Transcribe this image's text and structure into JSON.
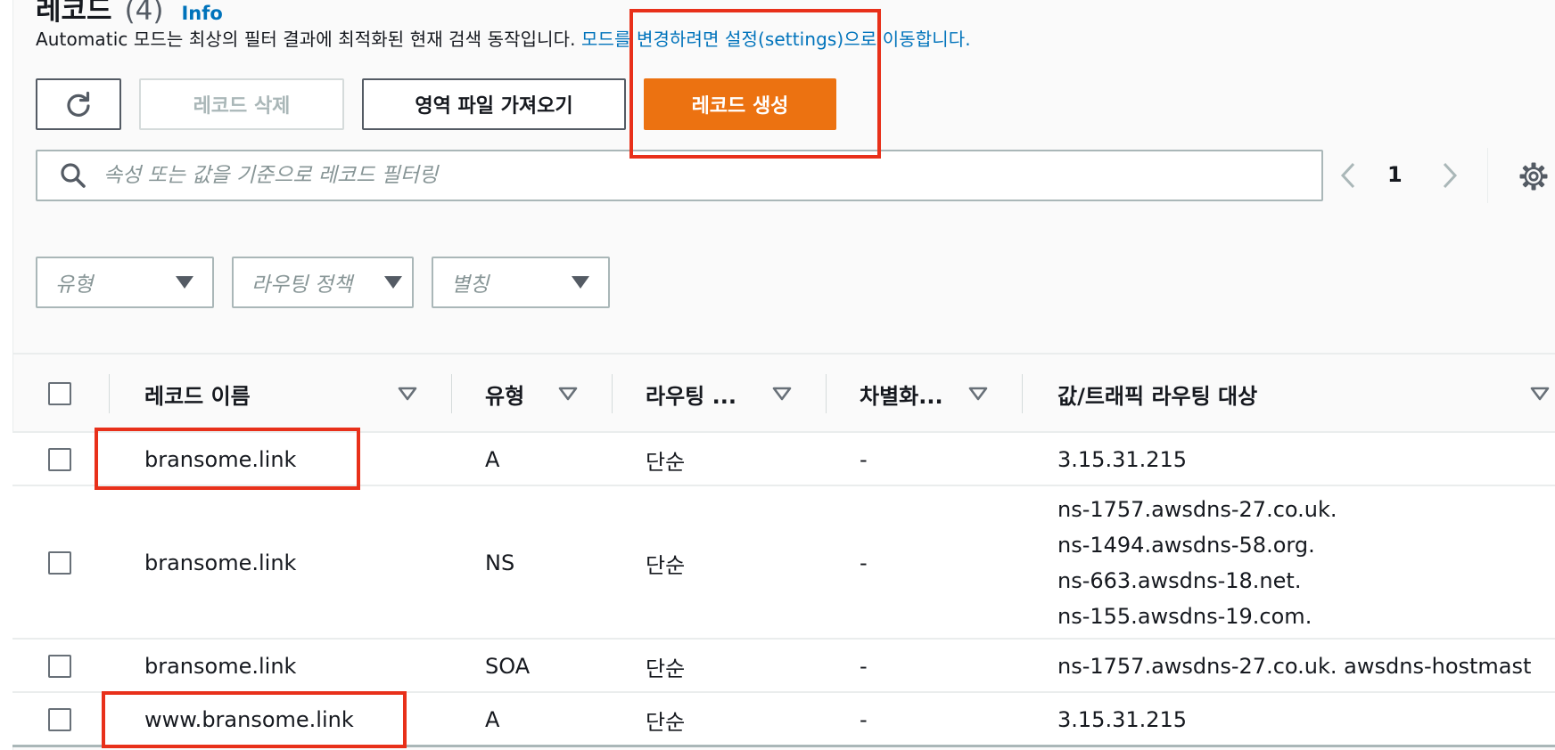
{
  "header": {
    "title": "레코드",
    "count": "(4)",
    "info_label": "Info"
  },
  "description": {
    "text": "Automatic 모드는 최상의 필터 결과에 최적화된 현재 검색 동작입니다.",
    "link": " 모드를 변경하려면 설정(settings)으로 이동합니다."
  },
  "toolbar": {
    "refresh_icon": "refresh-icon",
    "delete_label": "레코드 삭제",
    "import_label": "영역 파일 가져오기",
    "create_label": "레코드 생성",
    "create_color": "#ec7211"
  },
  "search": {
    "placeholder": "속성 또는 값을 기준으로 레코드 필터링",
    "value": ""
  },
  "pagination": {
    "current_page": "1"
  },
  "filters": {
    "type_placeholder": "유형",
    "routing_placeholder": "라우팅 정책",
    "alias_placeholder": "별칭"
  },
  "table": {
    "columns": [
      "레코드 이름",
      "유형",
      "라우팅 ...",
      "차별화...",
      "값/트래픽 라우팅 대상"
    ],
    "rows": [
      {
        "name": "bransome.link",
        "type": "A",
        "routing": "단순",
        "diff": "-",
        "values": [
          "3.15.31.215"
        ]
      },
      {
        "name": "bransome.link",
        "type": "NS",
        "routing": "단순",
        "diff": "-",
        "values": [
          "ns-1757.awsdns-27.co.uk.",
          "ns-1494.awsdns-58.org.",
          "ns-663.awsdns-18.net.",
          "ns-155.awsdns-19.com."
        ]
      },
      {
        "name": "bransome.link",
        "type": "SOA",
        "routing": "단순",
        "diff": "-",
        "values": [
          "ns-1757.awsdns-27.co.uk. awsdns-hostmast"
        ]
      },
      {
        "name": "www.bransome.link",
        "type": "A",
        "routing": "단순",
        "diff": "-",
        "values": [
          "3.15.31.215"
        ]
      }
    ]
  },
  "colors": {
    "highlight": "#e8301a",
    "link": "#0073bb"
  }
}
